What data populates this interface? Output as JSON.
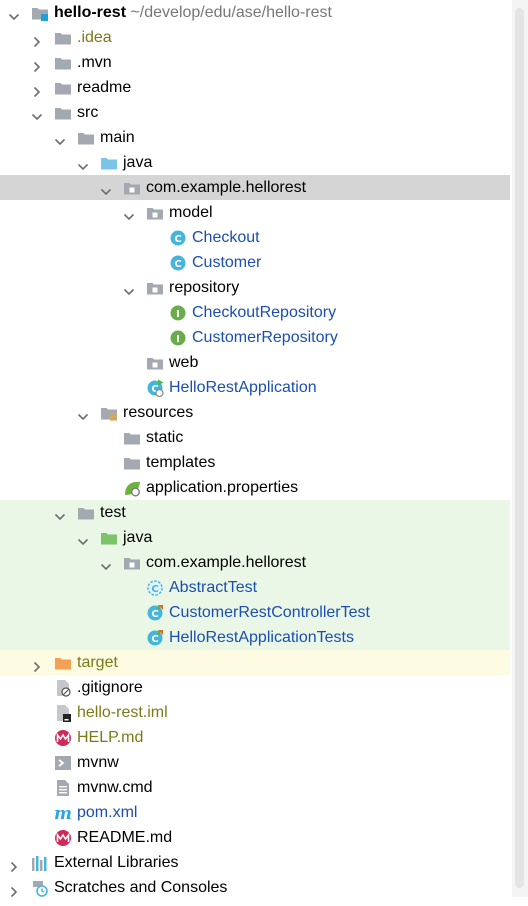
{
  "colors": {
    "selected_row": "#d5d5d5",
    "test_source_row": "#eaf7e6",
    "excluded_row": "#fdfbe2",
    "class_icon": "#46b5dc",
    "interface_icon": "#6aac4c"
  },
  "tree": [
    {
      "indent": 0,
      "arrow": "expanded",
      "icon": "module-folder-icon",
      "label": "hello-rest",
      "suffix": "~/develop/edu/ase/hello-rest",
      "style": "bold"
    },
    {
      "indent": 1,
      "arrow": "collapsed",
      "icon": "folder-icon",
      "label": ".idea",
      "style": "olive"
    },
    {
      "indent": 1,
      "arrow": "collapsed",
      "icon": "folder-icon",
      "label": ".mvn"
    },
    {
      "indent": 1,
      "arrow": "collapsed",
      "icon": "folder-icon",
      "label": "readme"
    },
    {
      "indent": 1,
      "arrow": "expanded",
      "icon": "folder-icon",
      "label": "src"
    },
    {
      "indent": 2,
      "arrow": "expanded",
      "icon": "folder-icon",
      "label": "main"
    },
    {
      "indent": 3,
      "arrow": "expanded",
      "icon": "source-folder-icon",
      "label": "java"
    },
    {
      "indent": 4,
      "arrow": "expanded",
      "icon": "package-icon",
      "label": "com.example.hellorest",
      "row": "sel"
    },
    {
      "indent": 5,
      "arrow": "expanded",
      "icon": "package-icon",
      "label": "model"
    },
    {
      "indent": 6,
      "icon": "class-icon",
      "label": "Checkout",
      "style": "blue"
    },
    {
      "indent": 6,
      "icon": "class-icon",
      "label": "Customer",
      "style": "blue"
    },
    {
      "indent": 5,
      "arrow": "expanded",
      "icon": "package-icon",
      "label": "repository"
    },
    {
      "indent": 6,
      "icon": "interface-icon",
      "label": "CheckoutRepository",
      "style": "blue"
    },
    {
      "indent": 6,
      "icon": "interface-icon",
      "label": "CustomerRepository",
      "style": "blue"
    },
    {
      "indent": 5,
      "icon": "package-icon",
      "label": "web"
    },
    {
      "indent": 5,
      "icon": "spring-boot-app-icon",
      "label": "HelloRestApplication",
      "style": "blue"
    },
    {
      "indent": 3,
      "arrow": "expanded",
      "icon": "resources-folder-icon",
      "label": "resources"
    },
    {
      "indent": 4,
      "icon": "folder-icon",
      "label": "static"
    },
    {
      "indent": 4,
      "icon": "folder-icon",
      "label": "templates"
    },
    {
      "indent": 4,
      "icon": "spring-properties-icon",
      "label": "application.properties"
    },
    {
      "indent": 2,
      "arrow": "expanded",
      "icon": "folder-icon",
      "label": "test",
      "row": "testsrc"
    },
    {
      "indent": 3,
      "arrow": "expanded",
      "icon": "test-folder-icon",
      "label": "java",
      "row": "testsrc"
    },
    {
      "indent": 4,
      "arrow": "expanded",
      "icon": "package-icon",
      "label": "com.example.hellorest",
      "row": "testsrc"
    },
    {
      "indent": 5,
      "icon": "abstract-class-icon",
      "label": "AbstractTest",
      "style": "blue",
      "row": "testsrc"
    },
    {
      "indent": 5,
      "icon": "test-class-icon",
      "label": "CustomerRestControllerTest",
      "style": "blue",
      "row": "testsrc"
    },
    {
      "indent": 5,
      "icon": "test-class-icon",
      "label": "HelloRestApplicationTests",
      "style": "blue",
      "row": "testsrc"
    },
    {
      "indent": 1,
      "arrow": "collapsed",
      "icon": "excluded-folder-icon",
      "label": "target",
      "style": "olive",
      "row": "excluded"
    },
    {
      "indent": 1,
      "icon": "ignore-file-icon",
      "label": ".gitignore"
    },
    {
      "indent": 1,
      "icon": "iml-file-icon",
      "label": "hello-rest.iml",
      "style": "olive"
    },
    {
      "indent": 1,
      "icon": "markdown-icon",
      "label": "HELP.md",
      "style": "olive"
    },
    {
      "indent": 1,
      "icon": "shell-script-icon",
      "label": "mvnw"
    },
    {
      "indent": 1,
      "icon": "text-file-icon",
      "label": "mvnw.cmd"
    },
    {
      "indent": 1,
      "icon": "maven-icon",
      "label": "pom.xml",
      "style": "blue"
    },
    {
      "indent": 1,
      "icon": "markdown-icon",
      "label": "README.md"
    },
    {
      "indent": 0,
      "arrow": "collapsed",
      "icon": "libraries-icon",
      "label": "External Libraries"
    },
    {
      "indent": 0,
      "arrow": "collapsed",
      "icon": "scratches-icon",
      "label": "Scratches and Consoles"
    }
  ]
}
